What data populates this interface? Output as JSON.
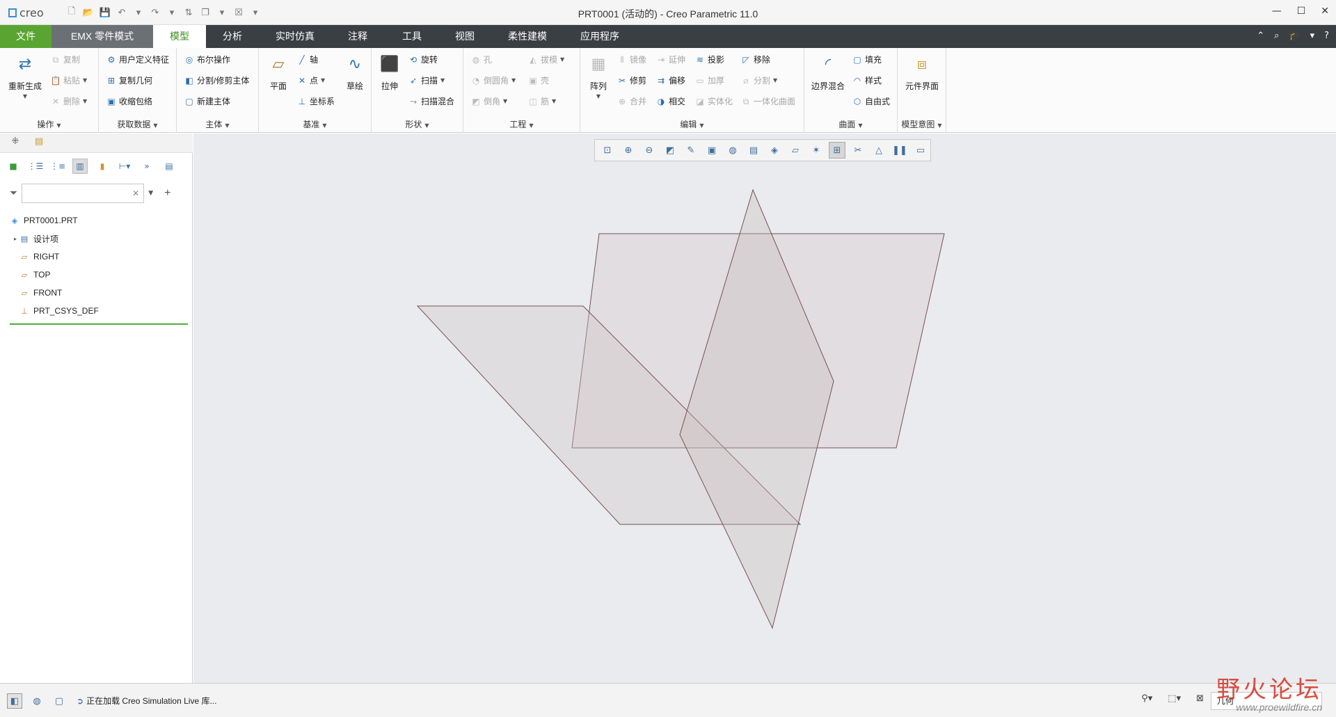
{
  "titlebar": {
    "logo": "creo",
    "title": "PRT0001 (活动的) - Creo Parametric 11.0",
    "minimize": "—",
    "maximize": "☐",
    "close": "✕"
  },
  "tabs": {
    "file": "文件",
    "emx": "EMX 零件模式",
    "model": "模型",
    "analysis": "分析",
    "simulation": "实时仿真",
    "annotate": "注释",
    "tools": "工具",
    "view": "视图",
    "flexible": "柔性建模",
    "apps": "应用程序"
  },
  "ribbon": {
    "operations": {
      "label": "操作",
      "regenerate": "重新生成",
      "copy": "复制",
      "paste": "粘贴",
      "delete": "删除"
    },
    "get_data": {
      "label": "获取数据",
      "udf": "用户定义特征",
      "copy_geom": "复制几何",
      "shrinkwrap": "收缩包络"
    },
    "body": {
      "label": "主体",
      "boolean": "布尔操作",
      "split": "分割/修剪主体",
      "new_body": "新建主体"
    },
    "datum": {
      "label": "基准",
      "plane": "平面",
      "axis": "轴",
      "point": "点",
      "csys": "坐标系",
      "sketch": "草绘"
    },
    "shapes": {
      "label": "形状",
      "extrude": "拉伸",
      "revolve": "旋转",
      "sweep": "扫描",
      "swept_blend": "扫描混合"
    },
    "engineering": {
      "label": "工程",
      "hole": "孔",
      "round": "倒圆角",
      "chamfer": "倒角",
      "draft": "拔模",
      "shell": "壳",
      "rib": "筋"
    },
    "editing": {
      "label": "编辑",
      "pattern": "阵列",
      "mirror": "镜像",
      "trim": "修剪",
      "merge": "合并",
      "extend": "延伸",
      "offset": "偏移",
      "intersect": "相交",
      "project": "投影",
      "thicken": "加厚",
      "solidify": "实体化",
      "remove": "移除",
      "split": "分割",
      "unify": "一体化曲面"
    },
    "surfaces": {
      "label": "曲面",
      "boundary_blend": "边界混合",
      "fill": "填充",
      "style": "样式",
      "freestyle": "自由式"
    },
    "model_intent": {
      "label": "模型意图",
      "component_interface": "元件界面"
    }
  },
  "tree": {
    "root": "PRT0001.PRT",
    "items": [
      {
        "label": "设计项"
      },
      {
        "label": "RIGHT"
      },
      {
        "label": "TOP"
      },
      {
        "label": "FRONT"
      },
      {
        "label": "PRT_CSYS_DEF"
      }
    ]
  },
  "filter": {
    "value": "",
    "placeholder": ""
  },
  "statusbar": {
    "message": "正在加载 Creo Simulation Live 库...",
    "filter_value": "几何"
  },
  "watermark": {
    "line1": "野火论坛",
    "line2": "www.proewildfire.cn"
  },
  "colors": {
    "file_tab": "#5aa532",
    "tabbar": "#3a3f44",
    "active_tab_text": "#3a8d1e",
    "viewport_bg": "#e9ebee",
    "plane_edge": "#7a5050"
  }
}
